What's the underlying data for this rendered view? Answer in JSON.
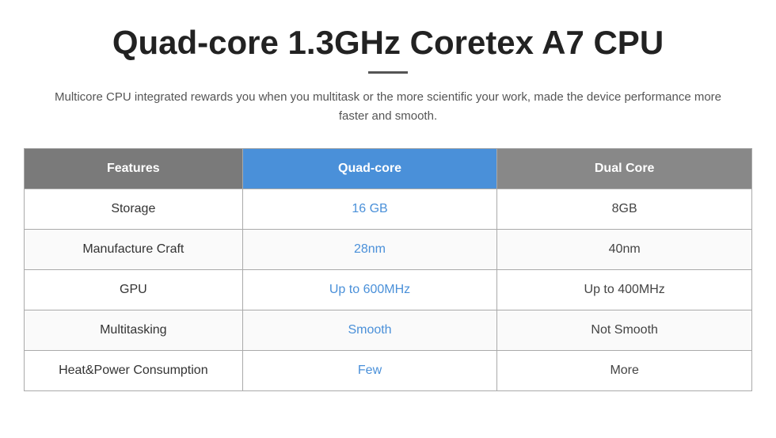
{
  "header": {
    "title": "Quad-core 1.3GHz Coretex A7 CPU",
    "subtitle": "Multicore CPU integrated rewards you when you multitask or the more scientific your work, made the device performance more faster and smooth."
  },
  "table": {
    "headers": {
      "features": "Features",
      "quad": "Quad-core",
      "dual": "Dual Core"
    },
    "rows": [
      {
        "label": "Storage",
        "quad_value": "16 GB",
        "dual_value": "8GB"
      },
      {
        "label": "Manufacture Craft",
        "quad_value": "28nm",
        "dual_value": "40nm"
      },
      {
        "label": "GPU",
        "quad_value": "Up to 600MHz",
        "dual_value": "Up to 400MHz"
      },
      {
        "label": "Multitasking",
        "quad_value": "Smooth",
        "dual_value": "Not Smooth"
      },
      {
        "label": "Heat&Power Consumption",
        "quad_value": "Few",
        "dual_value": "More"
      }
    ]
  }
}
